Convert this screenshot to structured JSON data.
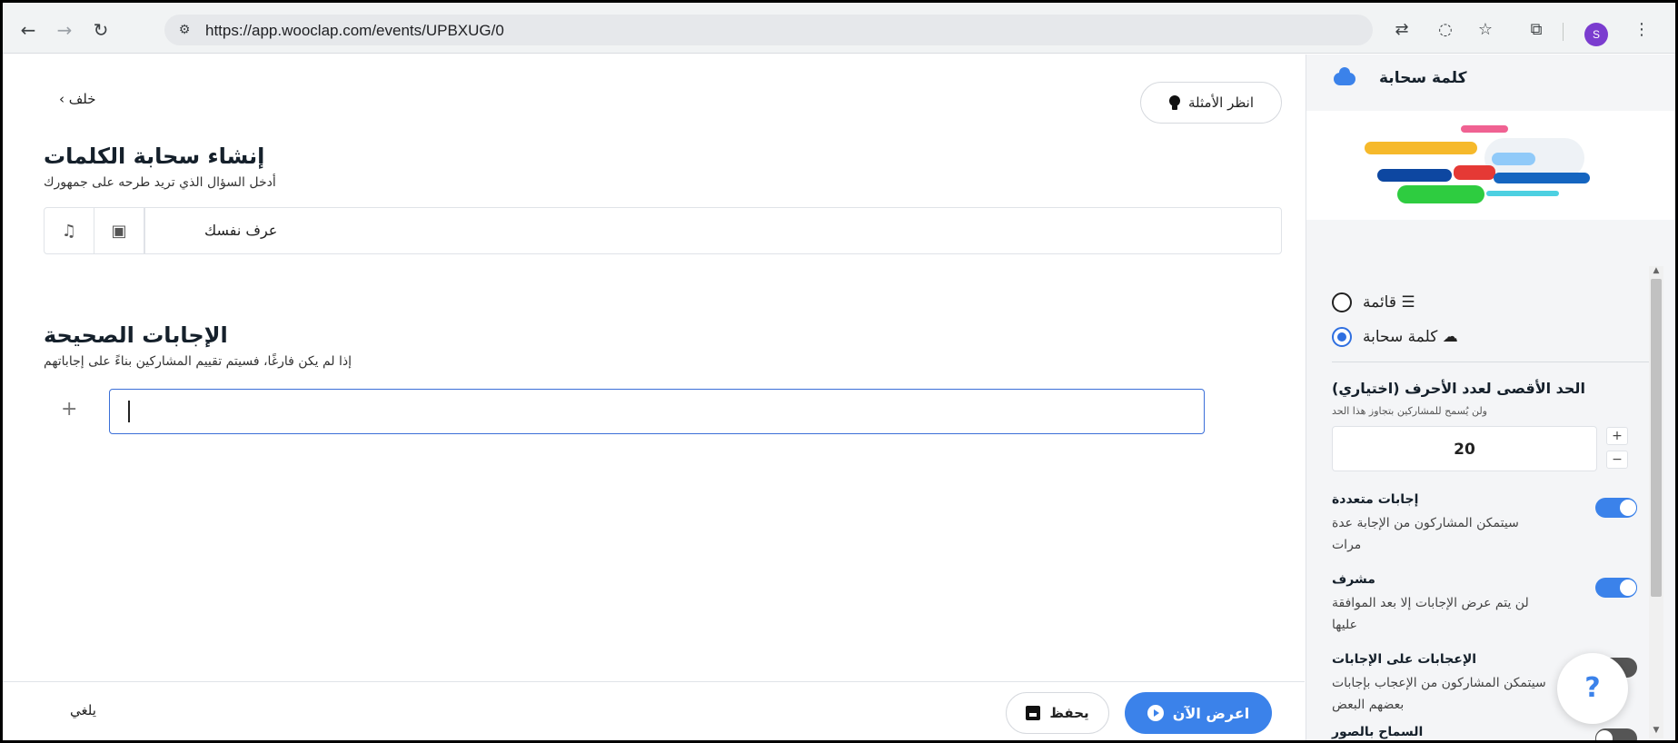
{
  "browser": {
    "url": "https://app.wooclap.com/events/UPBXUG/0",
    "avatar_letter": "S"
  },
  "editor": {
    "back_label": "خلف",
    "examples_label": "انظر الأمثلة",
    "title": "إنشاء سحابة الكلمات",
    "subtitle": "أدخل السؤال الذي تريد طرحه على جمهورك",
    "question_value": "عرف نفسك",
    "answers_title": "الإجابات الصحيحة",
    "answers_subtitle": "إذا لم يكن فارغًا، فسيتم تقييم المشاركين بناءً على إجاباتهم",
    "add_symbol": "+"
  },
  "footer": {
    "cancel_label": "يلغي",
    "save_label": "يحفظ",
    "present_label": "اعرض الآن"
  },
  "side": {
    "title": "كلمة سحابة",
    "options": [
      {
        "label": "قائمة",
        "selected": false
      },
      {
        "label": "كلمة سحابة",
        "selected": true
      }
    ],
    "limit_title": "الحد الأقصى لعدد الأحرف (اختياري)",
    "limit_subtitle": "ولن يُسمح للمشاركين بتجاوز هذا الحد",
    "limit_value": "20",
    "toggles": [
      {
        "title": "إجابات متعددة",
        "desc": "سيتمكن المشاركون من الإجابة عدة مرات",
        "on": true
      },
      {
        "title": "مشرف",
        "desc": "لن يتم عرض الإجابات إلا بعد الموافقة عليها",
        "on": true
      },
      {
        "title": "الإعجابات على الإجابات",
        "desc": "سيتمكن المشاركون من الإعجاب بإجابات بعضهم البعض",
        "on": false
      },
      {
        "title": "السماح بالصور",
        "desc": "",
        "on": false
      }
    ],
    "help_label": "?"
  },
  "colors": {
    "accent": "#3b82ea",
    "cloud_bars": [
      "#f06292",
      "#f6b92b",
      "#90caf9",
      "#0d47a1",
      "#e53935",
      "#1565c0",
      "#2ecc40",
      "#4dd0e1"
    ]
  }
}
